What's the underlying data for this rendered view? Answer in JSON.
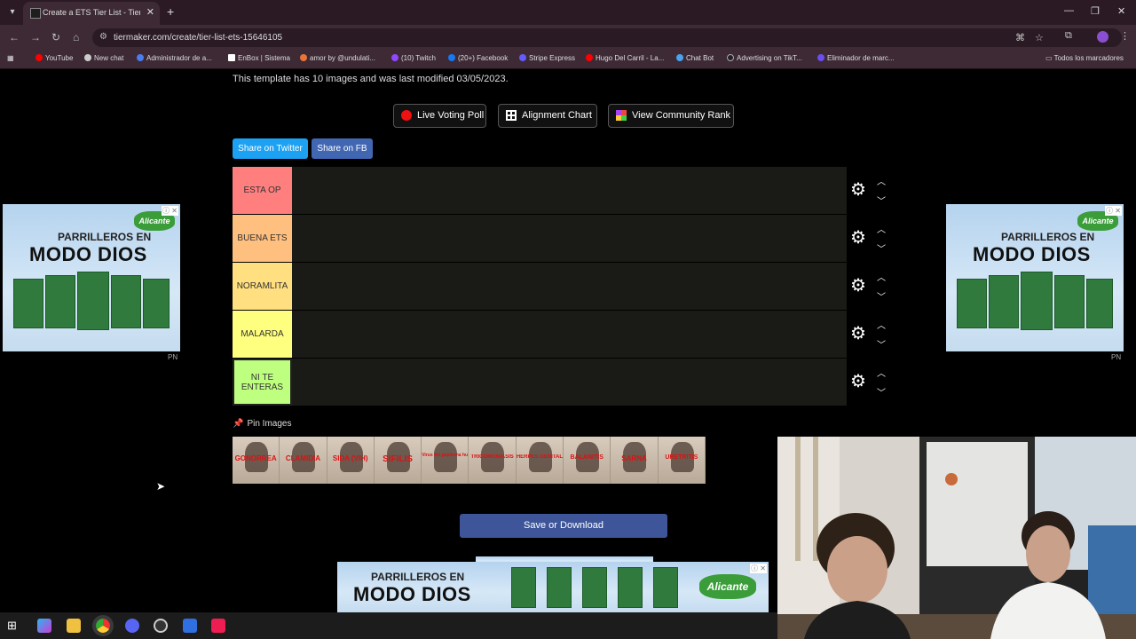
{
  "browser": {
    "tab_title": "Create a ETS Tier List - TierMaker",
    "url": "tiermaker.com/create/tier-list-ets-15646105",
    "bookmarks": [
      "YouTube",
      "New chat",
      "Administrador de a...",
      "EnBox | Sistema",
      "amor by @undulati...",
      "(10) Twitch",
      "(20+) Facebook",
      "Stripe Express",
      "Hugo Del Carril - La...",
      "Chat Bot",
      "Advertising on TikT...",
      "Eliminador de marc..."
    ],
    "all_bookmarks": "Todos los marcadores"
  },
  "page": {
    "template_info": "This template has 10 images and was last modified 03/05/2023.",
    "buttons": {
      "live_voting": "Live Voting Poll",
      "alignment": "Alignment Chart",
      "community_rank": "View Community Rank"
    },
    "share": {
      "twitter": "Share on Twitter",
      "fb": "Share on FB"
    },
    "tiers": [
      {
        "label": "ESTA OP",
        "color": "#ff7f7f"
      },
      {
        "label": "BUENA ETS",
        "color": "#ffbf7f"
      },
      {
        "label": "NORAMLITA",
        "color": "#ffdf7f"
      },
      {
        "label": "MALARDA",
        "color": "#ffff7f"
      },
      {
        "label": "NI TE ENTERAS",
        "color": "#bfff7f"
      }
    ],
    "pin_images": "Pin Images",
    "image_captions": [
      "GONORREA",
      "CLAMIDIA",
      "SIDA (VIH)",
      "SIFILIS",
      "Virus del papiloma humano",
      "TRICOMONIASIS",
      "HERPES GENITAL",
      "BALANITIS",
      "SARNA",
      "URETRITIS"
    ],
    "save_button": "Save or Download"
  },
  "ads": {
    "line1": "PARRILLEROS EN",
    "line2": "MODO DIOS",
    "brand": "Alicante",
    "tag": "PN",
    "close": "ⓘ ✕"
  }
}
